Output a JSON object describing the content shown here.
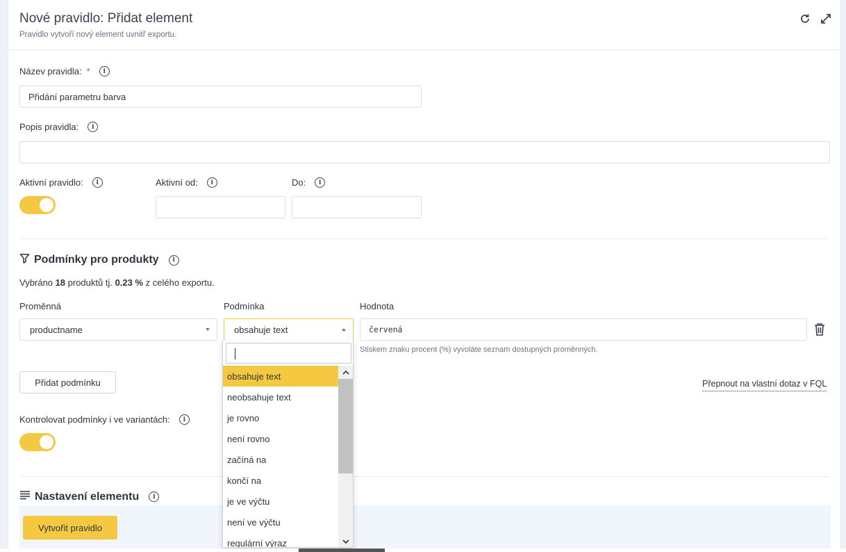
{
  "header": {
    "title": "Nové pravidlo: Přidat element",
    "subtitle": "Pravidlo vytvoří nový element uvnitř exportu."
  },
  "form": {
    "rule_name_label": "Název pravidla:",
    "rule_name_required": "*",
    "rule_name_value": "Přidání parametru barva",
    "rule_desc_label": "Popis pravidla:",
    "rule_desc_value": "",
    "active_label": "Aktivní pravidlo:",
    "active_on": true,
    "active_from_label": "Aktivní od:",
    "active_from_value": "",
    "active_to_label": "Do:",
    "active_to_value": ""
  },
  "conditions": {
    "title": "Podmínky pro produkty",
    "summary_prefix": "Vybráno ",
    "summary_count": "18",
    "summary_mid": " produktů tj. ",
    "summary_percent": "0.23 %",
    "summary_suffix": " z celého exportu.",
    "col_variable": "Proměnná",
    "col_condition": "Podmínka",
    "col_value": "Hodnota",
    "variable_value": "productname",
    "condition_value": "obsahuje text",
    "value_value": "červená",
    "value_hint": "Stiskem znaku procent (%) vyvoláte seznam dostupných proměnných.",
    "add_condition_button": "Přidat podmínku",
    "fql_link": "Přepnout na vlastní dotaz v FQL",
    "variants_label": "Kontrolovat podmínky i ve variantách:",
    "variants_on": true
  },
  "dropdown": {
    "search_value": "",
    "options": [
      "obsahuje text",
      "neobsahuje text",
      "je rovno",
      "není rovno",
      "začíná na",
      "končí na",
      "je ve výčtu",
      "není ve výčtu",
      "regulární výraz"
    ],
    "selected_index": 0
  },
  "element_settings": {
    "title": "Nastavení elementu",
    "create_button": "Vytvořit pravidlo"
  },
  "colors": {
    "accent": "#f5c842",
    "required": "#e0453a",
    "panel": "#f1f6fc"
  }
}
